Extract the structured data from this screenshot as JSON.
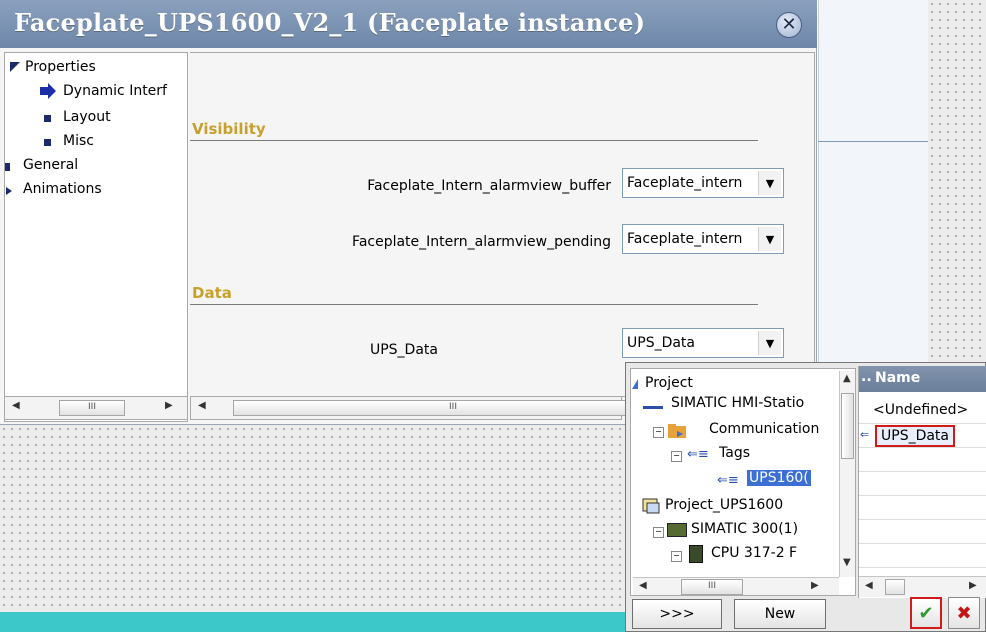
{
  "dialog": {
    "title": "Faceplate_UPS1600_V2_1 (Faceplate instance)"
  },
  "tree": {
    "items": [
      {
        "label": "Properties",
        "icon": "expanded-triangle-icon"
      },
      {
        "label": "Dynamic Interf",
        "icon": "blue-arrow-icon"
      },
      {
        "label": "Layout",
        "icon": "square-bullet-icon"
      },
      {
        "label": "Misc",
        "icon": "square-bullet-icon"
      },
      {
        "label": "General",
        "icon": "square-bullet-icon"
      },
      {
        "label": "Animations",
        "icon": "collapsed-triangle-icon"
      }
    ]
  },
  "sections": {
    "visibility": "Visibility",
    "data": "Data"
  },
  "properties": {
    "buffer": {
      "label": "Faceplate_Intern_alarmview_buffer",
      "value": "Faceplate_intern"
    },
    "pending": {
      "label": "Faceplate_Intern_alarmview_pending",
      "value": "Faceplate_intern"
    },
    "ups_data": {
      "label": "UPS_Data",
      "value": "UPS_Data"
    }
  },
  "scrollbar_grip": "III",
  "picker": {
    "tree_items": [
      {
        "label": "Project"
      },
      {
        "label": "SIMATIC HMI-Statio"
      },
      {
        "label": "Communication"
      },
      {
        "label": "Tags"
      },
      {
        "label": "UPS160("
      },
      {
        "label": "Project_UPS1600"
      },
      {
        "label": "SIMATIC 300(1)"
      },
      {
        "label": "CPU 317-2 F"
      }
    ],
    "list_header": "Name",
    "list_header_prefix": "..",
    "list_rows": [
      {
        "label": "<Undefined>"
      },
      {
        "label": "UPS_Data"
      }
    ],
    "more_button": ">>>",
    "new_button": "New"
  },
  "colors": {
    "section_header": "#c7a12e",
    "title_bar": "#7b92b3",
    "selection": "#3b6fd4",
    "highlight_border": "#d11a1a",
    "canvas_strip": "#3cc8c8"
  }
}
